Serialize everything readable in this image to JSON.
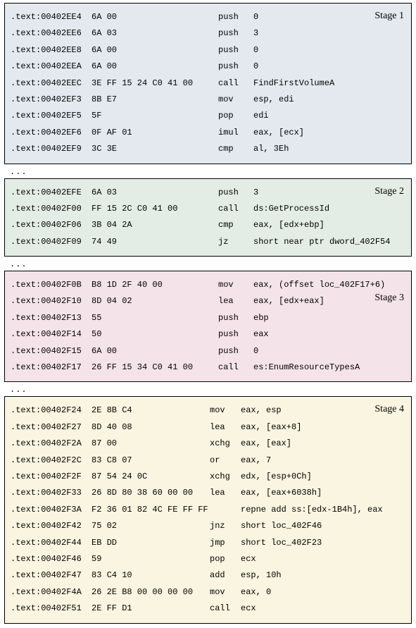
{
  "stages": {
    "stage1": {
      "label": "Stage 1",
      "lines": [
        {
          "addr": ".text:00402EE4",
          "bytes": "6A 00",
          "mnem": "push",
          "oper": "0"
        },
        {
          "addr": ".text:00402EE6",
          "bytes": "6A 03",
          "mnem": "push",
          "oper": "3"
        },
        {
          "addr": ".text:00402EE8",
          "bytes": "6A 00",
          "mnem": "push",
          "oper": "0"
        },
        {
          "addr": ".text:00402EEA",
          "bytes": "6A 00",
          "mnem": "push",
          "oper": "0"
        },
        {
          "addr": ".text:00402EEC",
          "bytes": "3E FF 15 24 C0 41 00",
          "mnem": "call",
          "oper": "FindFirstVolumeA"
        },
        {
          "addr": ".text:00402EF3",
          "bytes": "8B E7",
          "mnem": "mov",
          "oper": "esp, edi"
        },
        {
          "addr": ".text:00402EF5",
          "bytes": "5F",
          "mnem": "pop",
          "oper": "edi"
        },
        {
          "addr": ".text:00402EF6",
          "bytes": "0F AF 01",
          "mnem": "imul",
          "oper": "eax, [ecx]"
        },
        {
          "addr": ".text:00402EF9",
          "bytes": "3C 3E",
          "mnem": "cmp",
          "oper": "al, 3Eh"
        }
      ]
    },
    "stage2": {
      "label": "Stage 2",
      "lines": [
        {
          "addr": ".text:00402EFE",
          "bytes": "6A 03",
          "mnem": "push",
          "oper": "3"
        },
        {
          "addr": ".text:00402F00",
          "bytes": "FF 15 2C C0 41 00",
          "mnem": "call",
          "oper": "ds:GetProcessId"
        },
        {
          "addr": ".text:00402F06",
          "bytes": "3B 04 2A",
          "mnem": "cmp",
          "oper": "eax, [edx+ebp]"
        },
        {
          "addr": ".text:00402F09",
          "bytes": "74 49",
          "mnem": "jz",
          "oper": "short near ptr dword_402F54"
        }
      ]
    },
    "stage3": {
      "label": "Stage 3",
      "lines": [
        {
          "addr": ".text:00402F0B",
          "bytes": "B8 1D 2F 40 00",
          "mnem": "mov",
          "oper": "eax, (offset loc_402F17+6)"
        },
        {
          "addr": ".text:00402F10",
          "bytes": "8D 04 02",
          "mnem": "lea",
          "oper": "eax, [edx+eax]"
        },
        {
          "addr": ".text:00402F13",
          "bytes": "55",
          "mnem": "push",
          "oper": "ebp"
        },
        {
          "addr": ".text:00402F14",
          "bytes": "50",
          "mnem": "push",
          "oper": "eax"
        },
        {
          "addr": ".text:00402F15",
          "bytes": "6A 00",
          "mnem": "push",
          "oper": "0"
        },
        {
          "addr": ".text:00402F17",
          "bytes": "26 FF 15 34 C0 41 00",
          "mnem": "call",
          "oper": "es:EnumResourceTypesA"
        }
      ]
    },
    "stage4": {
      "label": "Stage 4",
      "lines": [
        {
          "addr": ".text:00402F24",
          "bytes": "2E 8B C4",
          "mnem": "mov",
          "oper": "eax, esp"
        },
        {
          "addr": ".text:00402F27",
          "bytes": "8D 40 08",
          "mnem": "lea",
          "oper": "eax, [eax+8]"
        },
        {
          "addr": ".text:00402F2A",
          "bytes": "87 00",
          "mnem": "xchg",
          "oper": "eax, [eax]"
        },
        {
          "addr": ".text:00402F2C",
          "bytes": "83 C8 07",
          "mnem": "or",
          "oper": "eax, 7"
        },
        {
          "addr": ".text:00402F2F",
          "bytes": "87 54 24 0C",
          "mnem": "xchg",
          "oper": "edx, [esp+0Ch]"
        },
        {
          "addr": ".text:00402F33",
          "bytes": "26 8D 80 38 60 00 00",
          "mnem": "lea",
          "oper": "eax, [eax+6038h]"
        },
        {
          "addr": ".text:00402F3A",
          "bytes": "F2 36 01 82 4C FE FF FF",
          "mnem": "",
          "oper": "repne add ss:[edx-1B4h], eax"
        },
        {
          "addr": ".text:00402F42",
          "bytes": "75 02",
          "mnem": "jnz",
          "oper": "short loc_402F46"
        },
        {
          "addr": ".text:00402F44",
          "bytes": "EB DD",
          "mnem": "jmp",
          "oper": "short loc_402F23"
        },
        {
          "addr": ".text:00402F46",
          "bytes": "59",
          "mnem": "pop",
          "oper": "ecx"
        },
        {
          "addr": ".text:00402F47",
          "bytes": "83 C4 10",
          "mnem": "add",
          "oper": "esp, 10h"
        },
        {
          "addr": ".text:00402F4A",
          "bytes": "26 2E B8 00 00 00 00",
          "mnem": "mov",
          "oper": "eax, 0"
        },
        {
          "addr": ".text:00402F51",
          "bytes": "2E FF D1",
          "mnem": "call",
          "oper": "ecx"
        }
      ]
    }
  },
  "ellipsis": "..."
}
